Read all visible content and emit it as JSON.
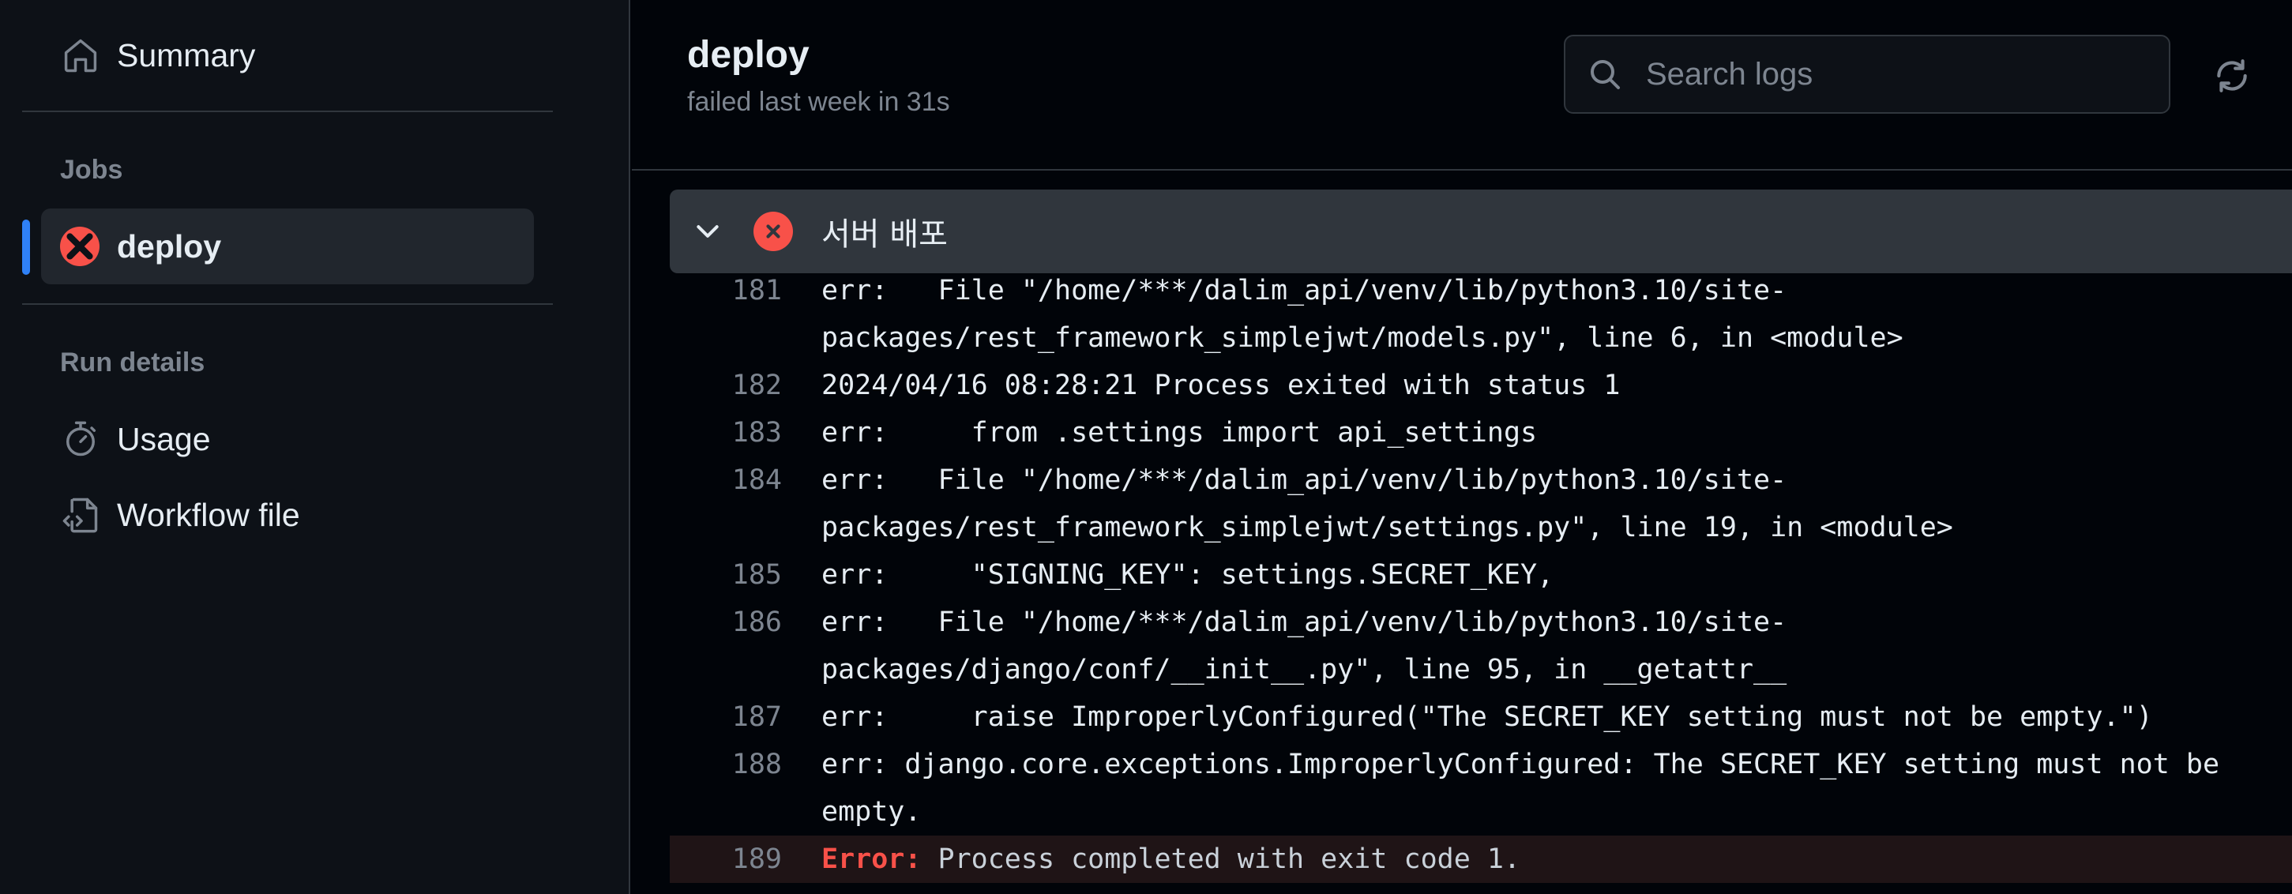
{
  "sidebar": {
    "summary_label": "Summary",
    "jobs_heading": "Jobs",
    "jobs": [
      {
        "label": "deploy",
        "status": "failed",
        "active": true
      }
    ],
    "run_details_heading": "Run details",
    "run_details": [
      {
        "label": "Usage",
        "icon": "stopwatch-icon"
      },
      {
        "label": "Workflow file",
        "icon": "file-code-icon"
      }
    ]
  },
  "header": {
    "title": "deploy",
    "subtitle": "failed last week in 31s",
    "search_placeholder": "Search logs"
  },
  "step": {
    "name": "서버 배포",
    "status": "failed"
  },
  "log": {
    "lines": [
      {
        "num": "181",
        "text": "err:   File \"/home/***/dalim_api/venv/lib/python3.10/site-packages/rest_framework_simplejwt/models.py\", line 6, in <module>"
      },
      {
        "num": "182",
        "text": "2024/04/16 08:28:21 Process exited with status 1"
      },
      {
        "num": "183",
        "text": "err:     from .settings import api_settings"
      },
      {
        "num": "184",
        "text": "err:   File \"/home/***/dalim_api/venv/lib/python3.10/site-packages/rest_framework_simplejwt/settings.py\", line 19, in <module>"
      },
      {
        "num": "185",
        "text": "err:     \"SIGNING_KEY\": settings.SECRET_KEY,"
      },
      {
        "num": "186",
        "text": "err:   File \"/home/***/dalim_api/venv/lib/python3.10/site-packages/django/conf/__init__.py\", line 95, in __getattr__"
      },
      {
        "num": "187",
        "text": "err:     raise ImproperlyConfigured(\"The SECRET_KEY setting must not be empty.\")"
      },
      {
        "num": "188",
        "text": "err: django.core.exceptions.ImproperlyConfigured: The SECRET_KEY setting must not be empty."
      }
    ],
    "error_line": {
      "num": "189",
      "label": "Error:",
      "text": " Process completed with exit code 1."
    }
  },
  "colors": {
    "accent": "#2f81f7",
    "error": "#f85149",
    "background": "#010409",
    "sidebar_bg": "#0d1117"
  }
}
